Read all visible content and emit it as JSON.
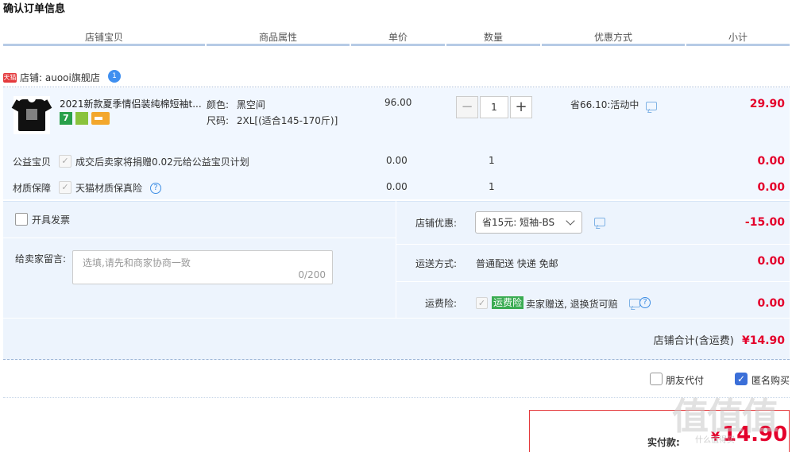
{
  "page_title": "确认订单信息",
  "columns": [
    "店铺宝贝",
    "商品属性",
    "单价",
    "数量",
    "优惠方式",
    "小计"
  ],
  "shop": {
    "badge": "天猫",
    "label": "店铺: auooi旗舰店",
    "wangwang_count": "1"
  },
  "item": {
    "title": "2021新款夏季情侣装纯棉短袖t...",
    "attr_color_label": "颜色:",
    "attr_color_value": "黑空间",
    "attr_size_label": "尺码:",
    "attr_size_value": "2XL[(适合145-170斤)]",
    "unit_price": "96.00",
    "quantity": "1",
    "minus": "−",
    "plus": "+",
    "promo": "省66.10:活动中",
    "subtotal": "29.90",
    "badge_7": "7"
  },
  "services": [
    {
      "label": "公益宝贝",
      "text": "成交后卖家将捐赠0.02元给公益宝贝计划",
      "price": "0.00",
      "qty": "1",
      "amount": "0.00"
    },
    {
      "label": "材质保障",
      "text": "天猫材质保真险",
      "price": "0.00",
      "qty": "1",
      "amount": "0.00"
    }
  ],
  "invoice_label": "开具发票",
  "message": {
    "label": "给卖家留言:",
    "placeholder": "选填,请先和商家协商一致",
    "counter": "0/200"
  },
  "shop_discount": {
    "label": "店铺优惠:",
    "selected": "省15元: 短袖-BS",
    "amount": "-15.00"
  },
  "shipping": {
    "label": "运送方式:",
    "value": "普通配送 快递 免邮",
    "amount": "0.00"
  },
  "shipping_insurance": {
    "label": "运费险:",
    "tag": "运费险",
    "text": "卖家赠送, 退换货可赔",
    "amount": "0.00"
  },
  "shop_total": {
    "label": "店铺合计(含运费)",
    "amount": "¥14.90"
  },
  "options": {
    "friend_pay": "朋友代付",
    "anonymous": "匿名购买"
  },
  "payment": {
    "label": "实付款:",
    "currency": "¥",
    "amount": "14.90"
  },
  "watermark": "值值值",
  "watermark_sub": "什么值得买",
  "colors": {
    "accent_red": "#e4002b",
    "header_line": "#b6cbe6",
    "panel_bg": "#edf4fd",
    "check_blue": "#3b6fd8"
  }
}
